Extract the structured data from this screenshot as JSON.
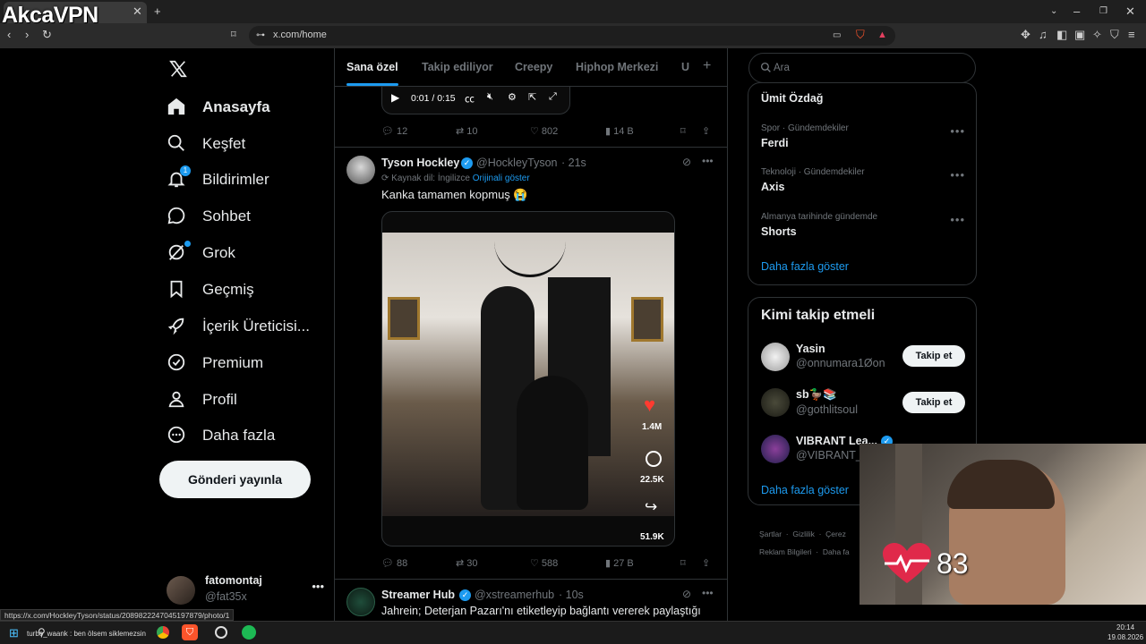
{
  "browser": {
    "url": "x.com/home",
    "status_url": "https://x.com/HockleyTyson/status/2089822247045197879/photo/1"
  },
  "watermark": {
    "text": "AkcaVPN"
  },
  "left_nav": {
    "items": [
      {
        "label": "Anasayfa",
        "icon": "home-icon"
      },
      {
        "label": "Keşfet",
        "icon": "search-icon"
      },
      {
        "label": "Bildirimler",
        "icon": "bell-icon",
        "badge": "1"
      },
      {
        "label": "Sohbet",
        "icon": "chat-icon"
      },
      {
        "label": "Grok",
        "icon": "grok-icon"
      },
      {
        "label": "Geçmiş",
        "icon": "bookmark-icon"
      },
      {
        "label": "İçerik Üreticisi...",
        "icon": "rocket-icon"
      },
      {
        "label": "Premium",
        "icon": "verified-icon"
      },
      {
        "label": "Profil",
        "icon": "person-icon"
      },
      {
        "label": "Daha fazla",
        "icon": "more-circle-icon"
      }
    ],
    "post_button": "Gönderi yayınla",
    "account": {
      "name": "fatomontaj",
      "handle": "@fat35x"
    }
  },
  "feed": {
    "tabs": [
      "Sana özel",
      "Takip ediliyor",
      "Creepy",
      "Hiphop Merkezi",
      "U"
    ],
    "video_time": "0:01 / 0:15",
    "prev_stats": {
      "replies": "12",
      "reposts": "10",
      "likes": "802",
      "views": "14 B"
    },
    "post1": {
      "name": "Tyson Hockley",
      "handle": "@HockleyTyson",
      "time": "· 21s",
      "translate_label": "Kaynak dil: İngilizce",
      "translate_link": "Orijinali göster",
      "text": "Kanka tamamen kopmuş 😭",
      "overlay_likes": "1.4M",
      "overlay_comments": "22.5K",
      "overlay_shares": "51.9K",
      "stats": {
        "replies": "88",
        "reposts": "30",
        "likes": "588",
        "views": "27 B"
      }
    },
    "post2": {
      "name": "Streamer Hub",
      "handle": "@xstreamerhub",
      "time": "· 10s",
      "text": "Jahrein; Deterjan Pazarı'nı etiketleyip bağlantı vererek paylaştığı"
    }
  },
  "right": {
    "search_placeholder": "Ara",
    "trends": [
      {
        "meta": "",
        "name": "Ümit Özdağ"
      },
      {
        "meta": "Spor · Gündemdekiler",
        "name": "Ferdi"
      },
      {
        "meta": "Teknoloji · Gündemdekiler",
        "name": "Axis"
      },
      {
        "meta": "Almanya tarihinde gündemde",
        "name": "Shorts"
      }
    ],
    "show_more": "Daha fazla göster",
    "who_to_follow_title": "Kimi takip etmeli",
    "follow": [
      {
        "name": "Yasin",
        "handle": "@onnumara1Øon",
        "button": "Takip et"
      },
      {
        "name": "sb🦆📚",
        "handle": "@gothlitsoul",
        "button": "Takip et"
      },
      {
        "name": "VIBRANT Lea...",
        "handle": "@VIBRANT_L",
        "button": ""
      }
    ],
    "show_more_2": "Daha fazla göster",
    "footer": [
      "Şartlar",
      "Gizlilik",
      "Çerez",
      "Reklam Bilgileri",
      "Daha fa"
    ]
  },
  "overlay": {
    "heart_rate": "83"
  },
  "taskbar": {
    "ticker": "turbo_waank : ben ölsem siklemezsin",
    "time": "20:14",
    "date": "19.08.2026"
  }
}
